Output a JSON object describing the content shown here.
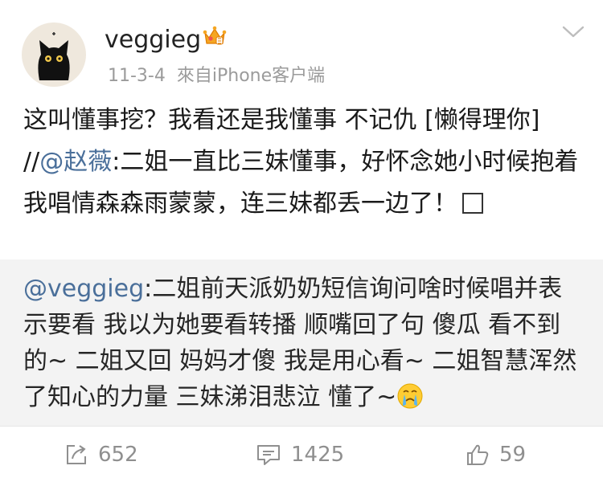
{
  "post": {
    "username": "veggieg",
    "date": "11-3-4",
    "source": "來自iPhone客户端",
    "text_before": "这叫懂事挖？我看还是我懂事 不记仇 [懒得理你] //",
    "mention": "@赵薇",
    "text_after": ":二姐一直比三妹懂事，好怀念她小时候抱着我唱情森森雨蒙蒙，连三妹都丢一边了！"
  },
  "quote": {
    "mention": "@veggieg",
    "text": ":二姐前天派奶奶短信询问啥时候唱并表示要看 我以为她要看转播 顺嘴回了句 傻瓜 看不到的~ 二姐又回 妈妈才傻 我是用心看~ 二姐智慧浑然了知心的力量 三妹涕泪悲泣 懂了~"
  },
  "actions": {
    "repost_count": "652",
    "comment_count": "1425",
    "like_count": "59"
  },
  "icons": [
    "avatar-cat",
    "crown-icon",
    "chevron-down-icon",
    "repost-icon",
    "comment-icon",
    "thumbs-up-icon",
    "crying-emoji-icon",
    "placeholder-box-icon"
  ]
}
